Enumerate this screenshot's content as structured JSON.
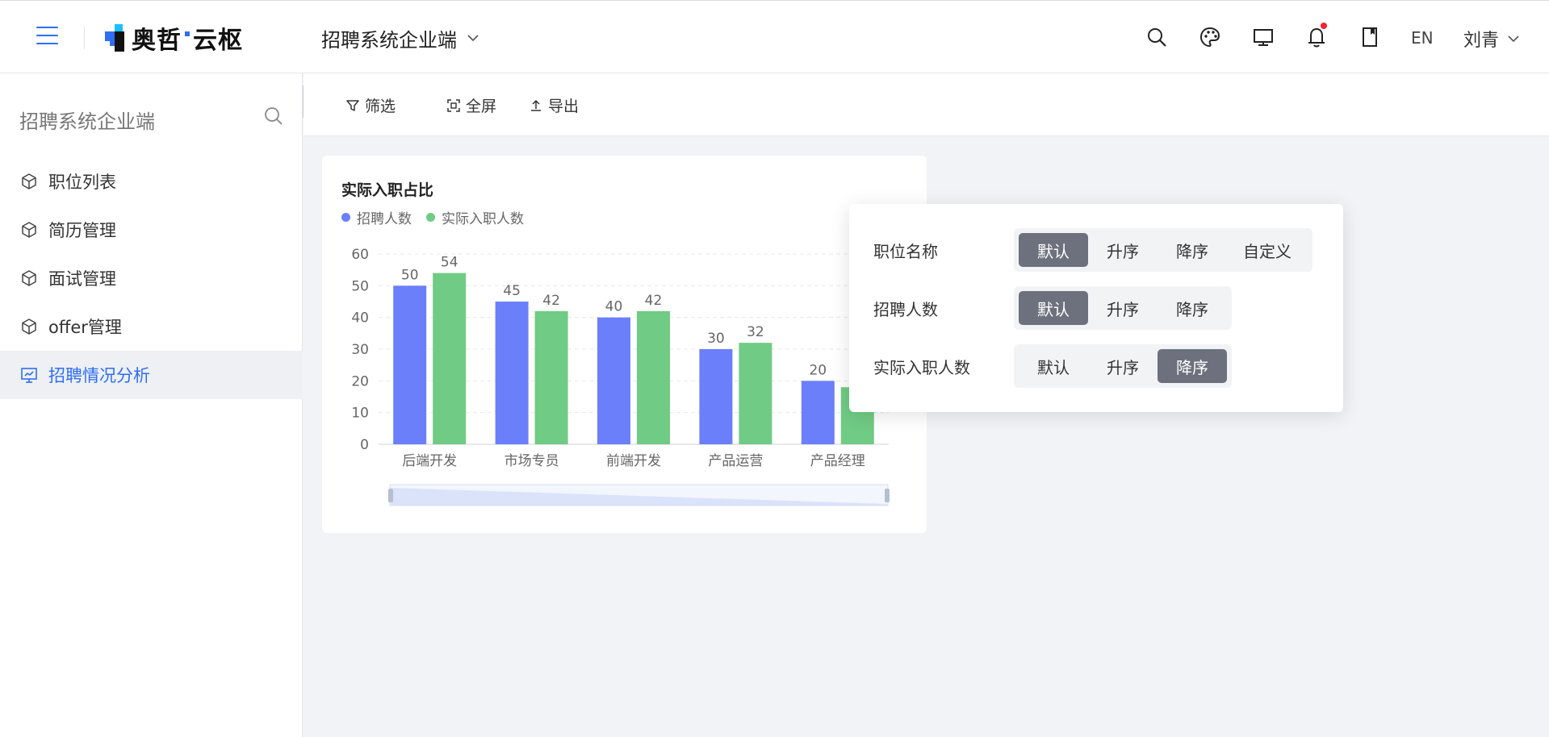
{
  "header": {
    "logo_text_a": "奥哲",
    "logo_text_b": "云枢",
    "app_name": "招聘系统企业端",
    "lang": "EN",
    "user": "刘青",
    "icons": [
      "search-icon",
      "palette-icon",
      "monitor-icon",
      "bell-icon",
      "bookmark-icon"
    ]
  },
  "sidebar": {
    "title": "招聘系统企业端",
    "items": [
      {
        "label": "职位列表",
        "icon": "cube-icon"
      },
      {
        "label": "简历管理",
        "icon": "cube-icon"
      },
      {
        "label": "面试管理",
        "icon": "cube-icon"
      },
      {
        "label": "offer管理",
        "icon": "cube-icon"
      },
      {
        "label": "招聘情况分析",
        "icon": "dashboard-icon",
        "active": true
      }
    ]
  },
  "toolbar": {
    "filter": "筛选",
    "fullscreen": "全屏",
    "export": "导出"
  },
  "card": {
    "title": "实际入职占比"
  },
  "colors": {
    "accent": "#2f6ef5",
    "series1": "#6b7ffb",
    "series2": "#70cb84"
  },
  "chart_data": {
    "type": "bar",
    "title": "实际入职占比",
    "categories": [
      "后端开发",
      "市场专员",
      "前端开发",
      "产品运营",
      "产品经理"
    ],
    "series": [
      {
        "name": "招聘人数",
        "values": [
          50,
          45,
          40,
          30,
          20
        ],
        "color": "#6b7ffb"
      },
      {
        "name": "实际入职人数",
        "values": [
          54,
          42,
          42,
          32,
          18
        ],
        "color": "#70cb84"
      }
    ],
    "y_ticks": [
      0,
      10,
      20,
      30,
      40,
      50,
      60
    ],
    "ylim": [
      0,
      60
    ],
    "grid": true,
    "legend": "top-left",
    "data_zoom": true
  },
  "sort_popup": {
    "rows": [
      {
        "label": "职位名称",
        "options": [
          "默认",
          "升序",
          "降序",
          "自定义"
        ],
        "selected": 0
      },
      {
        "label": "招聘人数",
        "options": [
          "默认",
          "升序",
          "降序"
        ],
        "selected": 0
      },
      {
        "label": "实际入职人数",
        "options": [
          "默认",
          "升序",
          "降序"
        ],
        "selected": 2
      }
    ]
  }
}
